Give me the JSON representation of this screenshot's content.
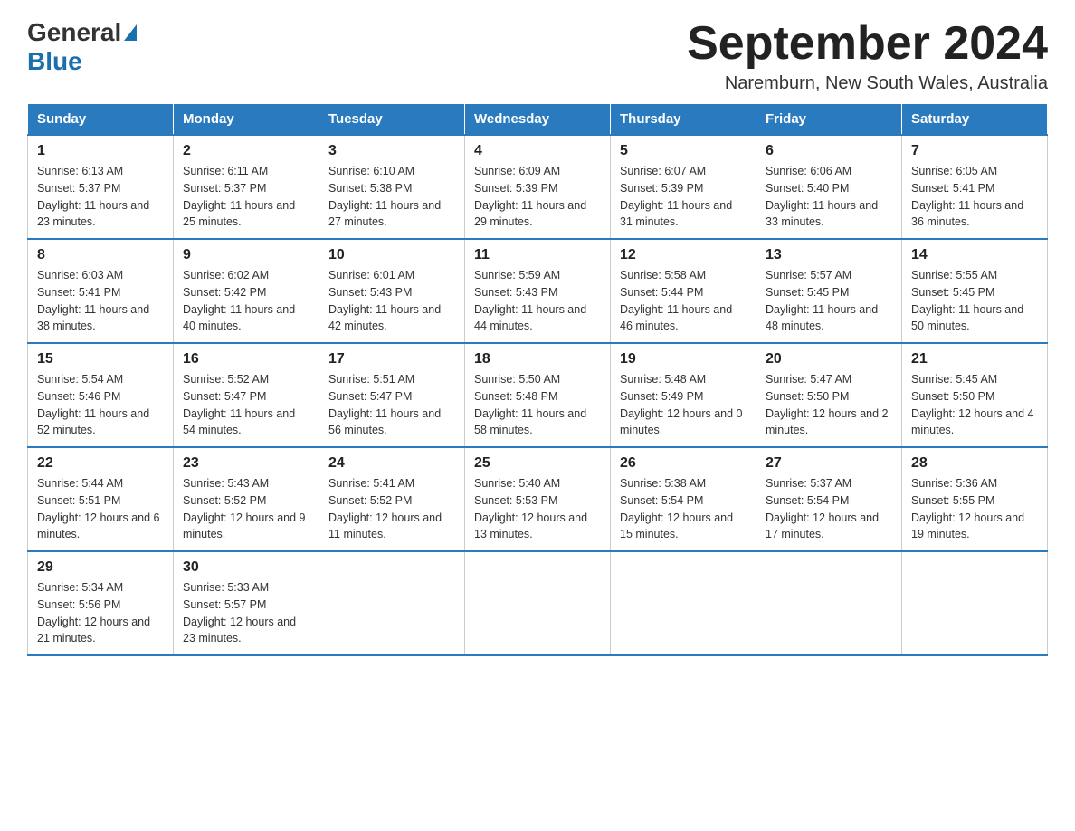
{
  "logo": {
    "general": "General",
    "blue": "Blue"
  },
  "title": "September 2024",
  "location": "Naremburn, New South Wales, Australia",
  "weekdays": [
    "Sunday",
    "Monday",
    "Tuesday",
    "Wednesday",
    "Thursday",
    "Friday",
    "Saturday"
  ],
  "weeks": [
    [
      {
        "day": "1",
        "sunrise": "6:13 AM",
        "sunset": "5:37 PM",
        "daylight": "11 hours and 23 minutes."
      },
      {
        "day": "2",
        "sunrise": "6:11 AM",
        "sunset": "5:37 PM",
        "daylight": "11 hours and 25 minutes."
      },
      {
        "day": "3",
        "sunrise": "6:10 AM",
        "sunset": "5:38 PM",
        "daylight": "11 hours and 27 minutes."
      },
      {
        "day": "4",
        "sunrise": "6:09 AM",
        "sunset": "5:39 PM",
        "daylight": "11 hours and 29 minutes."
      },
      {
        "day": "5",
        "sunrise": "6:07 AM",
        "sunset": "5:39 PM",
        "daylight": "11 hours and 31 minutes."
      },
      {
        "day": "6",
        "sunrise": "6:06 AM",
        "sunset": "5:40 PM",
        "daylight": "11 hours and 33 minutes."
      },
      {
        "day": "7",
        "sunrise": "6:05 AM",
        "sunset": "5:41 PM",
        "daylight": "11 hours and 36 minutes."
      }
    ],
    [
      {
        "day": "8",
        "sunrise": "6:03 AM",
        "sunset": "5:41 PM",
        "daylight": "11 hours and 38 minutes."
      },
      {
        "day": "9",
        "sunrise": "6:02 AM",
        "sunset": "5:42 PM",
        "daylight": "11 hours and 40 minutes."
      },
      {
        "day": "10",
        "sunrise": "6:01 AM",
        "sunset": "5:43 PM",
        "daylight": "11 hours and 42 minutes."
      },
      {
        "day": "11",
        "sunrise": "5:59 AM",
        "sunset": "5:43 PM",
        "daylight": "11 hours and 44 minutes."
      },
      {
        "day": "12",
        "sunrise": "5:58 AM",
        "sunset": "5:44 PM",
        "daylight": "11 hours and 46 minutes."
      },
      {
        "day": "13",
        "sunrise": "5:57 AM",
        "sunset": "5:45 PM",
        "daylight": "11 hours and 48 minutes."
      },
      {
        "day": "14",
        "sunrise": "5:55 AM",
        "sunset": "5:45 PM",
        "daylight": "11 hours and 50 minutes."
      }
    ],
    [
      {
        "day": "15",
        "sunrise": "5:54 AM",
        "sunset": "5:46 PM",
        "daylight": "11 hours and 52 minutes."
      },
      {
        "day": "16",
        "sunrise": "5:52 AM",
        "sunset": "5:47 PM",
        "daylight": "11 hours and 54 minutes."
      },
      {
        "day": "17",
        "sunrise": "5:51 AM",
        "sunset": "5:47 PM",
        "daylight": "11 hours and 56 minutes."
      },
      {
        "day": "18",
        "sunrise": "5:50 AM",
        "sunset": "5:48 PM",
        "daylight": "11 hours and 58 minutes."
      },
      {
        "day": "19",
        "sunrise": "5:48 AM",
        "sunset": "5:49 PM",
        "daylight": "12 hours and 0 minutes."
      },
      {
        "day": "20",
        "sunrise": "5:47 AM",
        "sunset": "5:50 PM",
        "daylight": "12 hours and 2 minutes."
      },
      {
        "day": "21",
        "sunrise": "5:45 AM",
        "sunset": "5:50 PM",
        "daylight": "12 hours and 4 minutes."
      }
    ],
    [
      {
        "day": "22",
        "sunrise": "5:44 AM",
        "sunset": "5:51 PM",
        "daylight": "12 hours and 6 minutes."
      },
      {
        "day": "23",
        "sunrise": "5:43 AM",
        "sunset": "5:52 PM",
        "daylight": "12 hours and 9 minutes."
      },
      {
        "day": "24",
        "sunrise": "5:41 AM",
        "sunset": "5:52 PM",
        "daylight": "12 hours and 11 minutes."
      },
      {
        "day": "25",
        "sunrise": "5:40 AM",
        "sunset": "5:53 PM",
        "daylight": "12 hours and 13 minutes."
      },
      {
        "day": "26",
        "sunrise": "5:38 AM",
        "sunset": "5:54 PM",
        "daylight": "12 hours and 15 minutes."
      },
      {
        "day": "27",
        "sunrise": "5:37 AM",
        "sunset": "5:54 PM",
        "daylight": "12 hours and 17 minutes."
      },
      {
        "day": "28",
        "sunrise": "5:36 AM",
        "sunset": "5:55 PM",
        "daylight": "12 hours and 19 minutes."
      }
    ],
    [
      {
        "day": "29",
        "sunrise": "5:34 AM",
        "sunset": "5:56 PM",
        "daylight": "12 hours and 21 minutes."
      },
      {
        "day": "30",
        "sunrise": "5:33 AM",
        "sunset": "5:57 PM",
        "daylight": "12 hours and 23 minutes."
      },
      null,
      null,
      null,
      null,
      null
    ]
  ]
}
